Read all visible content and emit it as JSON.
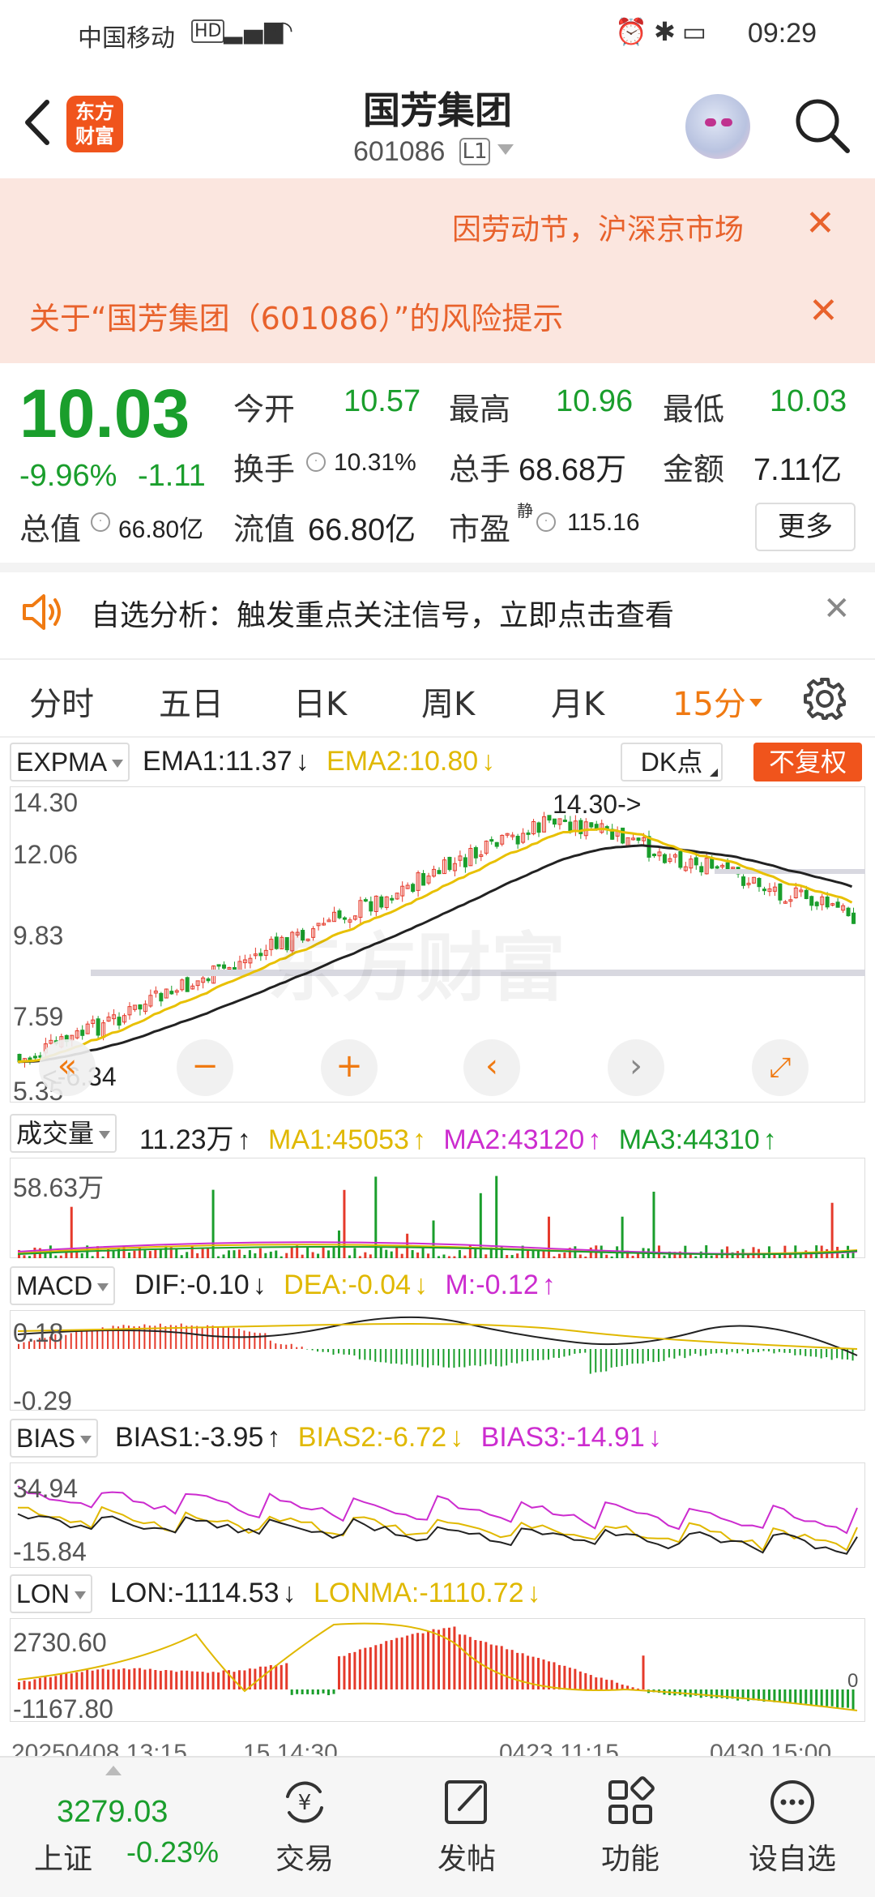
{
  "status_bar": {
    "carrier": "中国移动",
    "time": "09:29"
  },
  "header": {
    "logo_text": "东方财富",
    "name": "国芳集团",
    "code": "601086",
    "level": "L1"
  },
  "notices": {
    "notice1": "因劳动节，沪深京市场",
    "notice2": "关于“国芳集团（601086）”的风险提示"
  },
  "quote": {
    "price": "10.03",
    "change_pct": "-9.96%",
    "change": "-1.11",
    "open_label": "今开",
    "open": "10.57",
    "high_label": "最高",
    "high": "10.96",
    "low_label": "最低",
    "low": "10.03",
    "turnover_label": "换手",
    "turnover": "10.31%",
    "volume_label": "总手",
    "volume": "68.68万",
    "amount_label": "金额",
    "amount": "7.11亿",
    "mktcap_label": "总值",
    "mktcap": "66.80亿",
    "float_label": "流值",
    "float": "66.80亿",
    "pe_label": "市盈",
    "pe_sup": "静",
    "pe": "115.16",
    "more": "更多"
  },
  "alert": {
    "text": "自选分析：触发重点关注信号，立即点击查看"
  },
  "tabs": [
    {
      "label": "分时"
    },
    {
      "label": "五日"
    },
    {
      "label": "日K"
    },
    {
      "label": "周K"
    },
    {
      "label": "月K"
    },
    {
      "label": "15分",
      "active": true
    }
  ],
  "kline": {
    "indicator": "EXPMA",
    "ema1": "EMA1:11.37",
    "ema2": "EMA2:10.80",
    "dk_button": "DK点",
    "adjust_button": "不复权",
    "y_labels": [
      "14.30",
      "12.06",
      "9.83",
      "7.59",
      "5.35"
    ],
    "high_marker": "14.30->",
    "low_marker": "<-6.34",
    "watermark": "东方财富",
    "colors": {
      "ema1": "#222222",
      "ema2": "#e8c000",
      "up": "#e53a2b",
      "down": "#1a9e2c"
    }
  },
  "volume": {
    "indicator": "成交量",
    "current": "11.23万",
    "ma1": "MA1:45053",
    "ma2": "MA2:43120",
    "ma3": "MA3:44310",
    "y_label": "58.63万"
  },
  "macd": {
    "indicator": "MACD",
    "dif": "DIF:-0.10",
    "dea": "DEA:-0.04",
    "m": "M:-0.12",
    "y_top": "0.18",
    "y_bottom": "-0.29"
  },
  "bias": {
    "indicator": "BIAS",
    "bias1": "BIAS1:-3.95",
    "bias2": "BIAS2:-6.72",
    "bias3": "BIAS3:-14.91",
    "y_top": "34.94",
    "y_bottom": "-15.84"
  },
  "lon": {
    "indicator": "LON",
    "lon": "LON:-1114.53",
    "lonma": "LONMA:-1110.72",
    "y_top": "2730.60",
    "y_bottom": "-1167.80",
    "zero": "0"
  },
  "time_axis": [
    "20250408 13:15",
    "15 14:30",
    "0423 11:15",
    "0430 15:00"
  ],
  "bottom_nav": {
    "index_value": "3279.03",
    "index_name": "上证",
    "index_change": "-0.23%",
    "items": [
      {
        "label": "交易",
        "icon": "trade-icon"
      },
      {
        "label": "发帖",
        "icon": "post-icon"
      },
      {
        "label": "功能",
        "icon": "function-icon"
      },
      {
        "label": "设自选",
        "icon": "watchlist-icon"
      }
    ]
  }
}
